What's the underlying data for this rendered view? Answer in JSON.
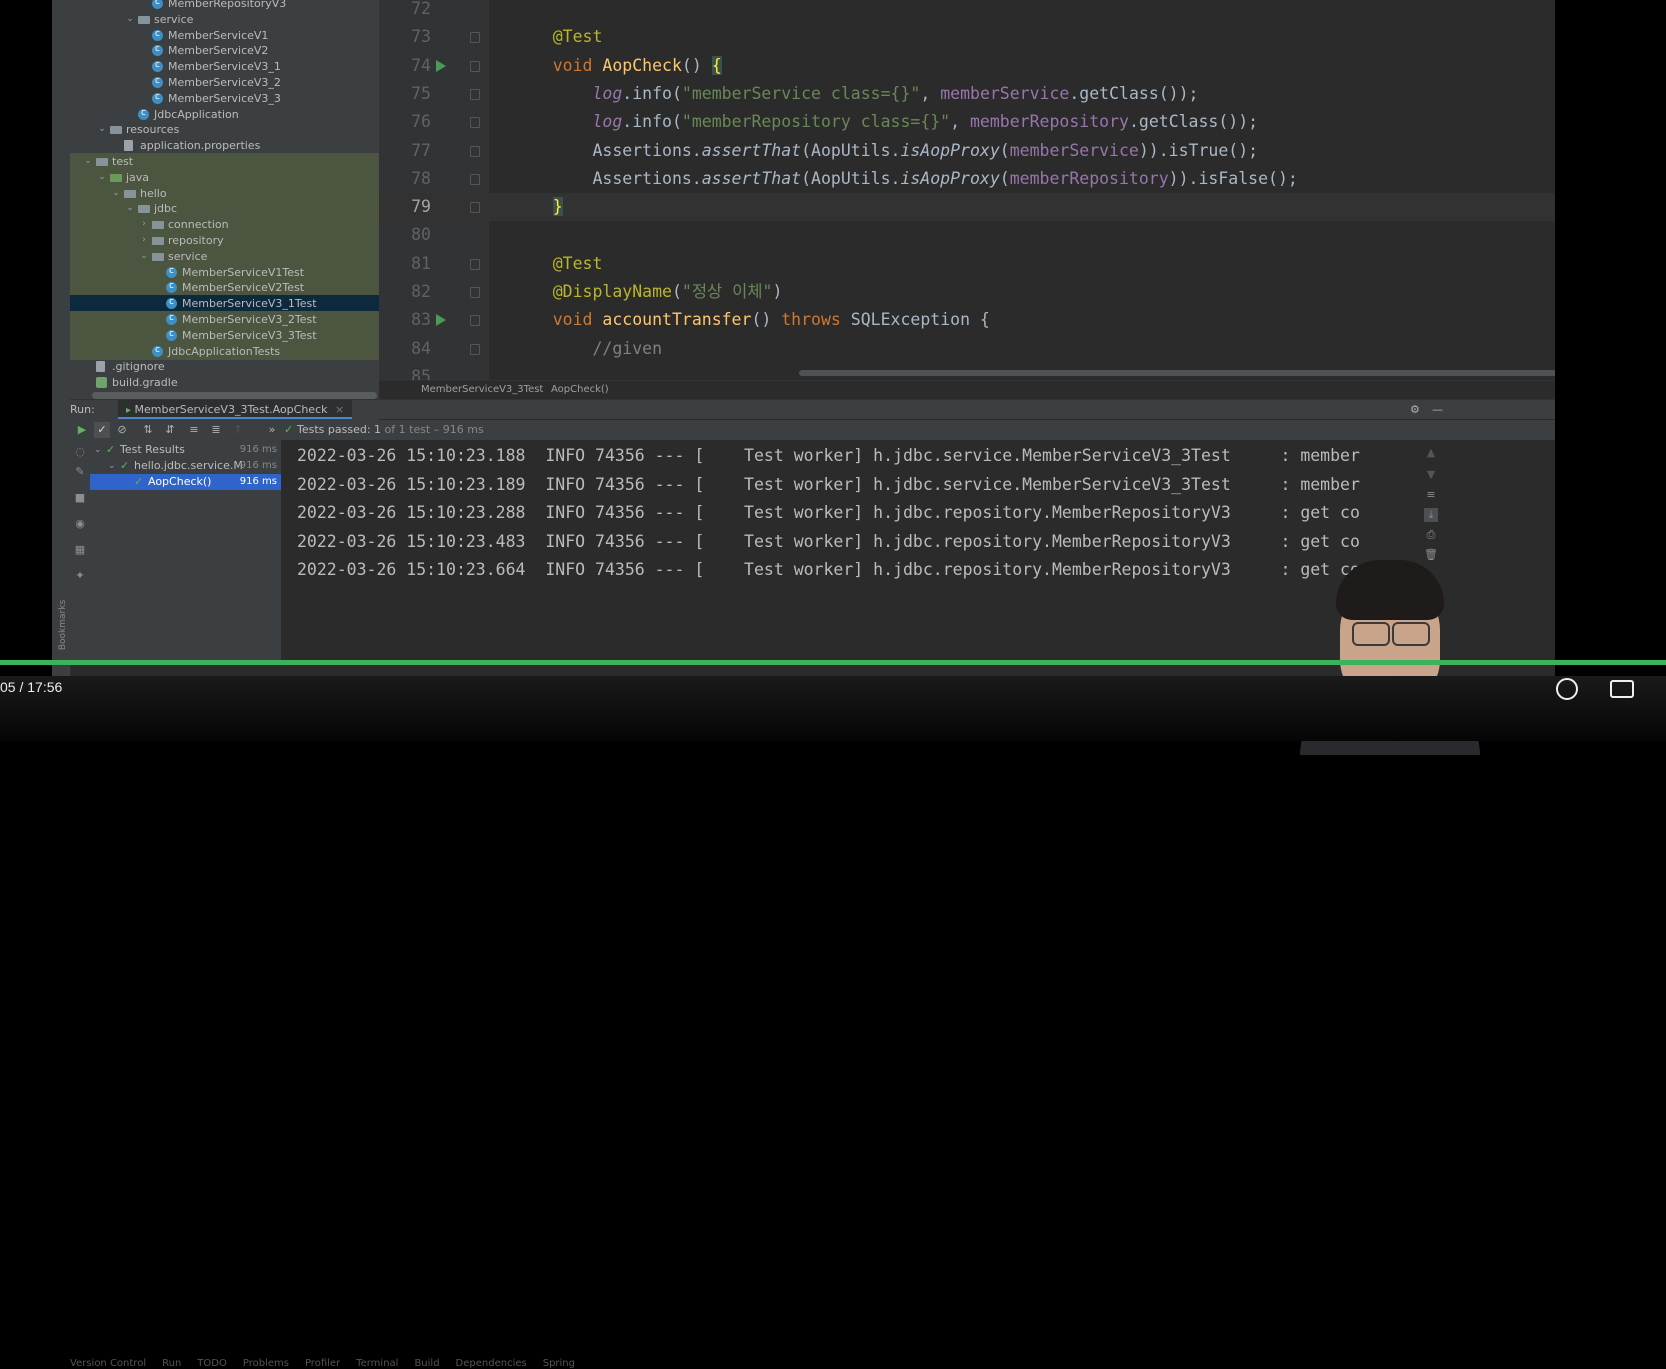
{
  "project_tree": [
    {
      "indent": 4,
      "arrow": "",
      "icon": "class",
      "label": "MemberRepositoryV3",
      "green": false,
      "sel": false
    },
    {
      "indent": 3,
      "arrow": "v",
      "icon": "folder",
      "label": "service",
      "green": false,
      "sel": false
    },
    {
      "indent": 4,
      "arrow": "",
      "icon": "class",
      "label": "MemberServiceV1",
      "green": false,
      "sel": false
    },
    {
      "indent": 4,
      "arrow": "",
      "icon": "class",
      "label": "MemberServiceV2",
      "green": false,
      "sel": false
    },
    {
      "indent": 4,
      "arrow": "",
      "icon": "class",
      "label": "MemberServiceV3_1",
      "green": false,
      "sel": false
    },
    {
      "indent": 4,
      "arrow": "",
      "icon": "class",
      "label": "MemberServiceV3_2",
      "green": false,
      "sel": false
    },
    {
      "indent": 4,
      "arrow": "",
      "icon": "class",
      "label": "MemberServiceV3_3",
      "green": false,
      "sel": false
    },
    {
      "indent": 3,
      "arrow": "",
      "icon": "class",
      "label": "JdbcApplication",
      "green": false,
      "sel": false
    },
    {
      "indent": 1,
      "arrow": "v",
      "icon": "folder-res",
      "label": "resources",
      "green": false,
      "sel": false
    },
    {
      "indent": 2,
      "arrow": "",
      "icon": "file",
      "label": "application.properties",
      "green": false,
      "sel": false
    },
    {
      "indent": 0,
      "arrow": "v",
      "icon": "folder",
      "label": "test",
      "green": true,
      "sel": false
    },
    {
      "indent": 1,
      "arrow": "v",
      "icon": "folder-test",
      "label": "java",
      "green": true,
      "sel": false
    },
    {
      "indent": 2,
      "arrow": "v",
      "icon": "folder",
      "label": "hello",
      "green": true,
      "sel": false
    },
    {
      "indent": 3,
      "arrow": "v",
      "icon": "folder",
      "label": "jdbc",
      "green": true,
      "sel": false
    },
    {
      "indent": 4,
      "arrow": ">",
      "icon": "folder",
      "label": "connection",
      "green": true,
      "sel": false
    },
    {
      "indent": 4,
      "arrow": ">",
      "icon": "folder",
      "label": "repository",
      "green": true,
      "sel": false
    },
    {
      "indent": 4,
      "arrow": "v",
      "icon": "folder",
      "label": "service",
      "green": true,
      "sel": false
    },
    {
      "indent": 5,
      "arrow": "",
      "icon": "class",
      "label": "MemberServiceV1Test",
      "green": true,
      "sel": false
    },
    {
      "indent": 5,
      "arrow": "",
      "icon": "class",
      "label": "MemberServiceV2Test",
      "green": true,
      "sel": false
    },
    {
      "indent": 5,
      "arrow": "",
      "icon": "class",
      "label": "MemberServiceV3_1Test",
      "green": false,
      "sel": true
    },
    {
      "indent": 5,
      "arrow": "",
      "icon": "class",
      "label": "MemberServiceV3_2Test",
      "green": true,
      "sel": false
    },
    {
      "indent": 5,
      "arrow": "",
      "icon": "class",
      "label": "MemberServiceV3_3Test",
      "green": true,
      "sel": false
    },
    {
      "indent": 4,
      "arrow": "",
      "icon": "class",
      "label": "JdbcApplicationTests",
      "green": true,
      "sel": false
    },
    {
      "indent": 0,
      "arrow": "",
      "icon": "file",
      "label": ".gitignore",
      "green": false,
      "sel": false
    },
    {
      "indent": 0,
      "arrow": "",
      "icon": "gradle",
      "label": "build.gradle",
      "green": false,
      "sel": false
    }
  ],
  "editor_lines": [
    {
      "n": "72",
      "run": false,
      "cur": false,
      "tokens": []
    },
    {
      "n": "73",
      "run": false,
      "cur": false,
      "tokens": [
        [
          "    ",
          ""
        ],
        [
          "@Test",
          "ann"
        ]
      ]
    },
    {
      "n": "74",
      "run": true,
      "cur": false,
      "tokens": [
        [
          "    ",
          ""
        ],
        [
          "void ",
          "kw"
        ],
        [
          "AopCheck",
          "fn"
        ],
        [
          "() ",
          ""
        ],
        [
          "{",
          "brace"
        ]
      ]
    },
    {
      "n": "75",
      "run": false,
      "cur": false,
      "tokens": [
        [
          "        ",
          ""
        ],
        [
          "log",
          "fld ital"
        ],
        [
          ".info(",
          ""
        ],
        [
          "\"memberService class={}\"",
          "str"
        ],
        [
          ", ",
          ""
        ],
        [
          "memberService",
          "fld"
        ],
        [
          ".getClass());",
          ""
        ]
      ]
    },
    {
      "n": "76",
      "run": false,
      "cur": false,
      "tokens": [
        [
          "        ",
          ""
        ],
        [
          "log",
          "fld ital"
        ],
        [
          ".info(",
          ""
        ],
        [
          "\"memberRepository class={}\"",
          "str"
        ],
        [
          ", ",
          ""
        ],
        [
          "memberRepository",
          "fld"
        ],
        [
          ".getClass());",
          ""
        ]
      ]
    },
    {
      "n": "77",
      "run": false,
      "cur": false,
      "tokens": [
        [
          "        Assertions.",
          ""
        ],
        [
          "assertThat",
          "ital"
        ],
        [
          "(AopUtils.",
          ""
        ],
        [
          "isAopProxy",
          "ital"
        ],
        [
          "(",
          ""
        ],
        [
          "memberService",
          "fld"
        ],
        [
          ")).isTrue();",
          ""
        ]
      ]
    },
    {
      "n": "78",
      "run": false,
      "cur": false,
      "tokens": [
        [
          "        Assertions.",
          ""
        ],
        [
          "assertThat",
          "ital"
        ],
        [
          "(AopUtils.",
          ""
        ],
        [
          "isAopProxy",
          "ital"
        ],
        [
          "(",
          ""
        ],
        [
          "memberRepository",
          "fld"
        ],
        [
          ")).isFalse();",
          ""
        ]
      ]
    },
    {
      "n": "79",
      "run": false,
      "cur": true,
      "tokens": [
        [
          "    ",
          ""
        ],
        [
          "}",
          "brace"
        ]
      ]
    },
    {
      "n": "80",
      "run": false,
      "cur": false,
      "tokens": []
    },
    {
      "n": "81",
      "run": false,
      "cur": false,
      "tokens": [
        [
          "    ",
          ""
        ],
        [
          "@Test",
          "ann"
        ]
      ]
    },
    {
      "n": "82",
      "run": false,
      "cur": false,
      "tokens": [
        [
          "    ",
          ""
        ],
        [
          "@DisplayName",
          "ann"
        ],
        [
          "(",
          ""
        ],
        [
          "\"정상 이체\"",
          "str"
        ],
        [
          ")",
          ""
        ]
      ]
    },
    {
      "n": "83",
      "run": true,
      "cur": false,
      "tokens": [
        [
          "    ",
          ""
        ],
        [
          "void ",
          "kw"
        ],
        [
          "accountTransfer",
          "fn"
        ],
        [
          "() ",
          ""
        ],
        [
          "throws ",
          "kw"
        ],
        [
          "SQLException {",
          ""
        ]
      ]
    },
    {
      "n": "84",
      "run": false,
      "cur": false,
      "tokens": [
        [
          "        ",
          ""
        ],
        [
          "//given",
          "cmt"
        ]
      ]
    },
    {
      "n": "85",
      "run": false,
      "cur": false,
      "tokens": []
    }
  ],
  "breadcrumb": {
    "class": "MemberServiceV3_3Test",
    "method": "AopCheck()"
  },
  "run_panel": {
    "label": "Run:",
    "tab": "MemberServiceV3_3Test.AopCheck",
    "status": "Tests passed:",
    "count": "1",
    "detail": "of 1 test – 916 ms"
  },
  "results_tree": [
    {
      "indent": 0,
      "label": "Test Results",
      "dur": "916 ms",
      "sel": false
    },
    {
      "indent": 1,
      "label": "hello.jdbc.service.Me",
      "dur": "916 ms",
      "sel": false
    },
    {
      "indent": 2,
      "label": "AopCheck()",
      "dur": "916 ms",
      "sel": true
    }
  ],
  "console_lines": [
    "2022-03-26 15:10:23.188  INFO 74356 --- [    Test worker] h.jdbc.service.MemberServiceV3_3Test     : member",
    "2022-03-26 15:10:23.189  INFO 74356 --- [    Test worker] h.jdbc.service.MemberServiceV3_3Test     : member",
    "2022-03-26 15:10:23.288  INFO 74356 --- [    Test worker] h.jdbc.repository.MemberRepositoryV3     : get co",
    "2022-03-26 15:10:23.483  INFO 74356 --- [    Test worker] h.jdbc.repository.MemberRepositoryV3     : get co",
    "2022-03-26 15:10:23.664  INFO 74356 --- [    Test worker] h.jdbc.repository.MemberRepositoryV3     : get co"
  ],
  "video": {
    "time": "05 / 17:56",
    "progress": 1.0
  },
  "side_label": "Bookmarks",
  "status_items": [
    "Version Control",
    "Run",
    "TODO",
    "Problems",
    "Profiler",
    "Terminal",
    "Build",
    "Dependencies",
    "Spring"
  ]
}
